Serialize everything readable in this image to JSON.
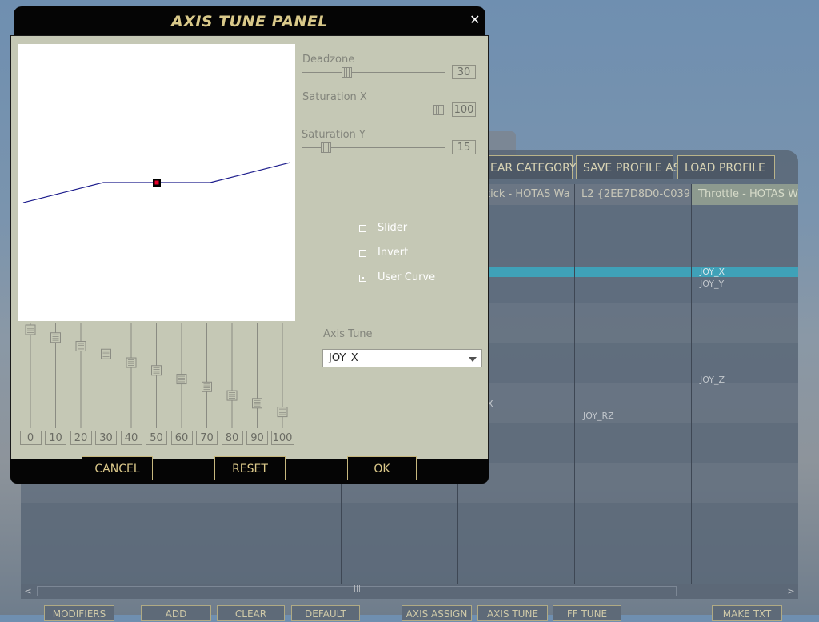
{
  "background": {
    "toolbar_buttons": [
      "EAR CATEGORY",
      "SAVE PROFILE AS",
      "LOAD PROFILE"
    ],
    "columns": [
      "tick - HOTAS Wa",
      "L2 {2EE7D8D0-C039",
      "Throttle - HOTAS W"
    ],
    "cells": {
      "joy_x": "JOY_X",
      "joy_y": "JOY_Y",
      "joy_z": "JOY_Z",
      "joy_rz": "JOY_RZ",
      "x_fragment": "X"
    },
    "bottom_buttons": [
      "MODIFIERS",
      "ADD",
      "CLEAR",
      "DEFAULT",
      "AXIS ASSIGN",
      "AXIS TUNE",
      "FF TUNE",
      "MAKE TXT"
    ],
    "scroll_left": "<",
    "scroll_right": ">",
    "scroll_grip": "|||"
  },
  "dialog": {
    "title": "AXIS TUNE PANEL",
    "close_glyph": "✕",
    "deadzone": {
      "label": "Deadzone",
      "value": "30"
    },
    "saturation_x": {
      "label": "Saturation X",
      "value": "100"
    },
    "saturation_y": {
      "label": "Saturation Y",
      "value": "15"
    },
    "options": [
      {
        "label": "Slider",
        "checked": false
      },
      {
        "label": "Invert",
        "checked": false
      },
      {
        "label": "User Curve",
        "checked": true
      }
    ],
    "axis_tune": {
      "label": "Axis Tune",
      "selected": "JOY_X"
    },
    "curve_points": [
      "0",
      "10",
      "20",
      "30",
      "40",
      "50",
      "60",
      "70",
      "80",
      "90",
      "100"
    ],
    "curve_slider_levels": [
      1.0,
      0.91,
      0.81,
      0.72,
      0.62,
      0.53,
      0.43,
      0.34,
      0.24,
      0.15,
      0.05
    ],
    "curve_line": [
      [
        0,
        -0.15
      ],
      [
        10,
        -0.1
      ],
      [
        20,
        -0.05
      ],
      [
        30,
        0.0
      ],
      [
        40,
        0.0
      ],
      [
        50,
        0.0
      ],
      [
        60,
        0.0
      ],
      [
        70,
        0.0
      ],
      [
        80,
        0.05
      ],
      [
        90,
        0.1
      ],
      [
        100,
        0.15
      ]
    ],
    "curve_marker_color": "#e8002a",
    "line_color": "#1c1c8c",
    "buttons": {
      "cancel": "CANCEL",
      "reset": "RESET",
      "ok": "OK"
    }
  }
}
